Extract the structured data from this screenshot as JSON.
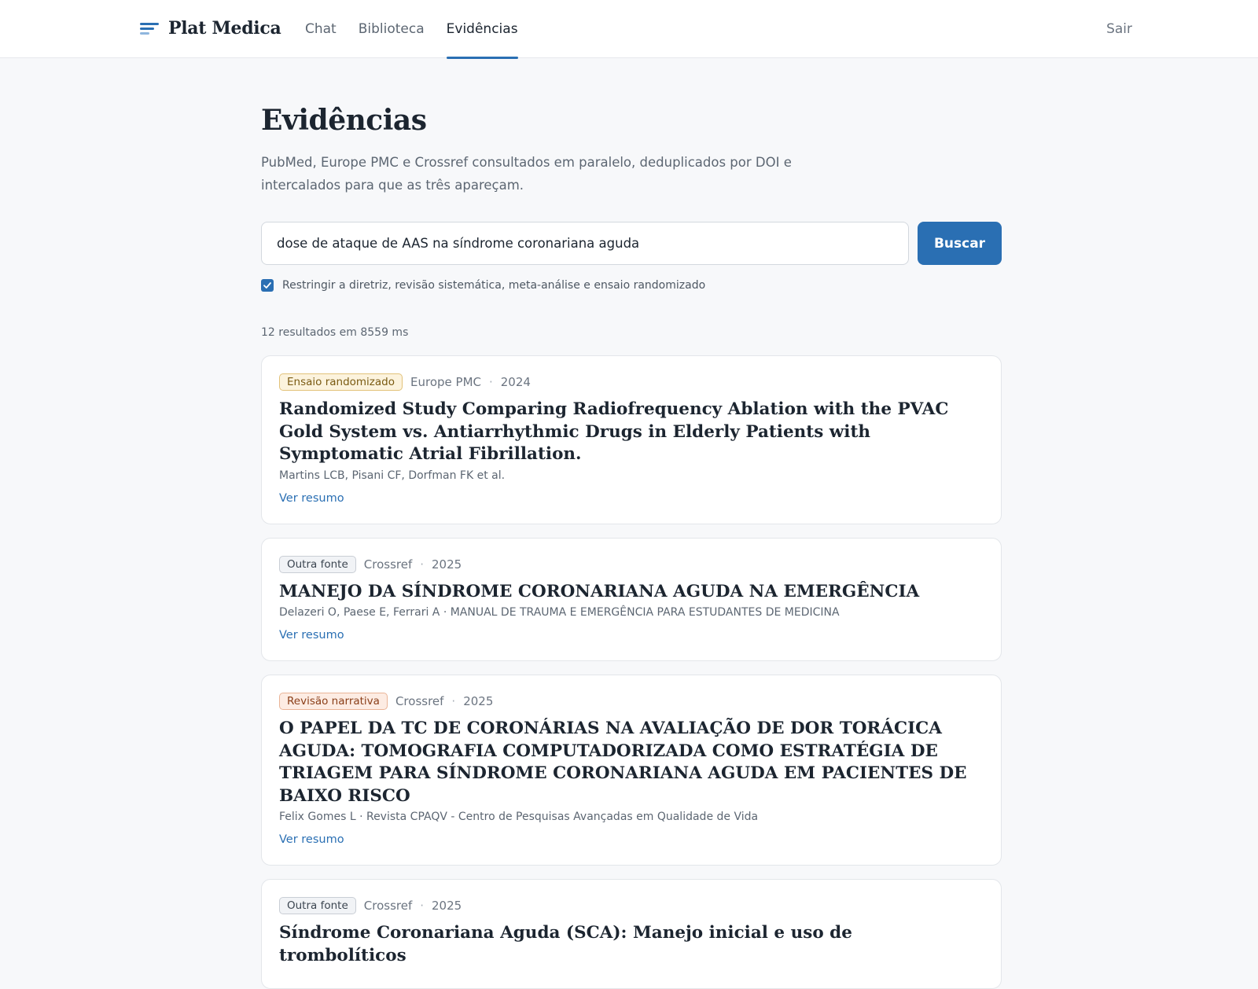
{
  "header": {
    "brand": "Plat Medica",
    "tabs": [
      {
        "label": "Chat"
      },
      {
        "label": "Biblioteca"
      },
      {
        "label": "Evidências"
      }
    ],
    "logout": "Sair"
  },
  "page": {
    "title": "Evidências",
    "subtitle": "PubMed, Europe PMC e Crossref consultados em paralelo, deduplicados por DOI e intercalados para que as três apareçam."
  },
  "search": {
    "value": "dose de ataque de AAS na síndrome coronariana aguda",
    "button": "Buscar",
    "filter_label": "Restringir a diretriz, revisão sistemática, meta-análise e ensaio randomizado",
    "filter_checked": true
  },
  "results": {
    "summary": "12 resultados em 8559 ms",
    "items": [
      {
        "badge": "Ensaio randomizado",
        "source": "Europe PMC",
        "year": "2024",
        "title": "Randomized Study Comparing Radiofrequency Ablation with the PVAC Gold System vs. Antiarrhythmic Drugs in Elderly Patients with Symptomatic Atrial Fibrillation.",
        "authors": "Martins LCB, Pisani CF, Dorfman FK et al.",
        "link": "Ver resumo"
      },
      {
        "badge": "Outra fonte",
        "source": "Crossref",
        "year": "2025",
        "title": "MANEJO DA SÍNDROME CORONARIANA AGUDA NA EMERGÊNCIA",
        "authors": "Delazeri O, Paese E, Ferrari A · MANUAL DE TRAUMA E EMERGÊNCIA PARA ESTUDANTES DE MEDICINA",
        "link": "Ver resumo"
      },
      {
        "badge": "Revisão narrativa",
        "source": "Crossref",
        "year": "2025",
        "title": "O PAPEL DA TC DE CORONÁRIAS NA AVALIAÇÃO DE DOR TORÁCICA AGUDA: TOMOGRAFIA COMPUTADORIZADA COMO ESTRATÉGIA DE TRIAGEM PARA SÍNDROME CORONARIANA AGUDA EM PACIENTES DE BAIXO RISCO",
        "authors": "Felix Gomes L · Revista CPAQV - Centro de Pesquisas Avançadas em Qualidade de Vida",
        "link": "Ver resumo"
      },
      {
        "badge": "Outra fonte",
        "source": "Crossref",
        "year": "2025",
        "title": "Síndrome Coronariana Aguda (SCA): Manejo inicial e uso de trombolíticos"
      }
    ]
  },
  "colors": {
    "accent": "#2a6fb3",
    "badge_rct": "#fcf3dd",
    "badge_other": "#f1f3f6",
    "badge_review": "#fdece3"
  }
}
